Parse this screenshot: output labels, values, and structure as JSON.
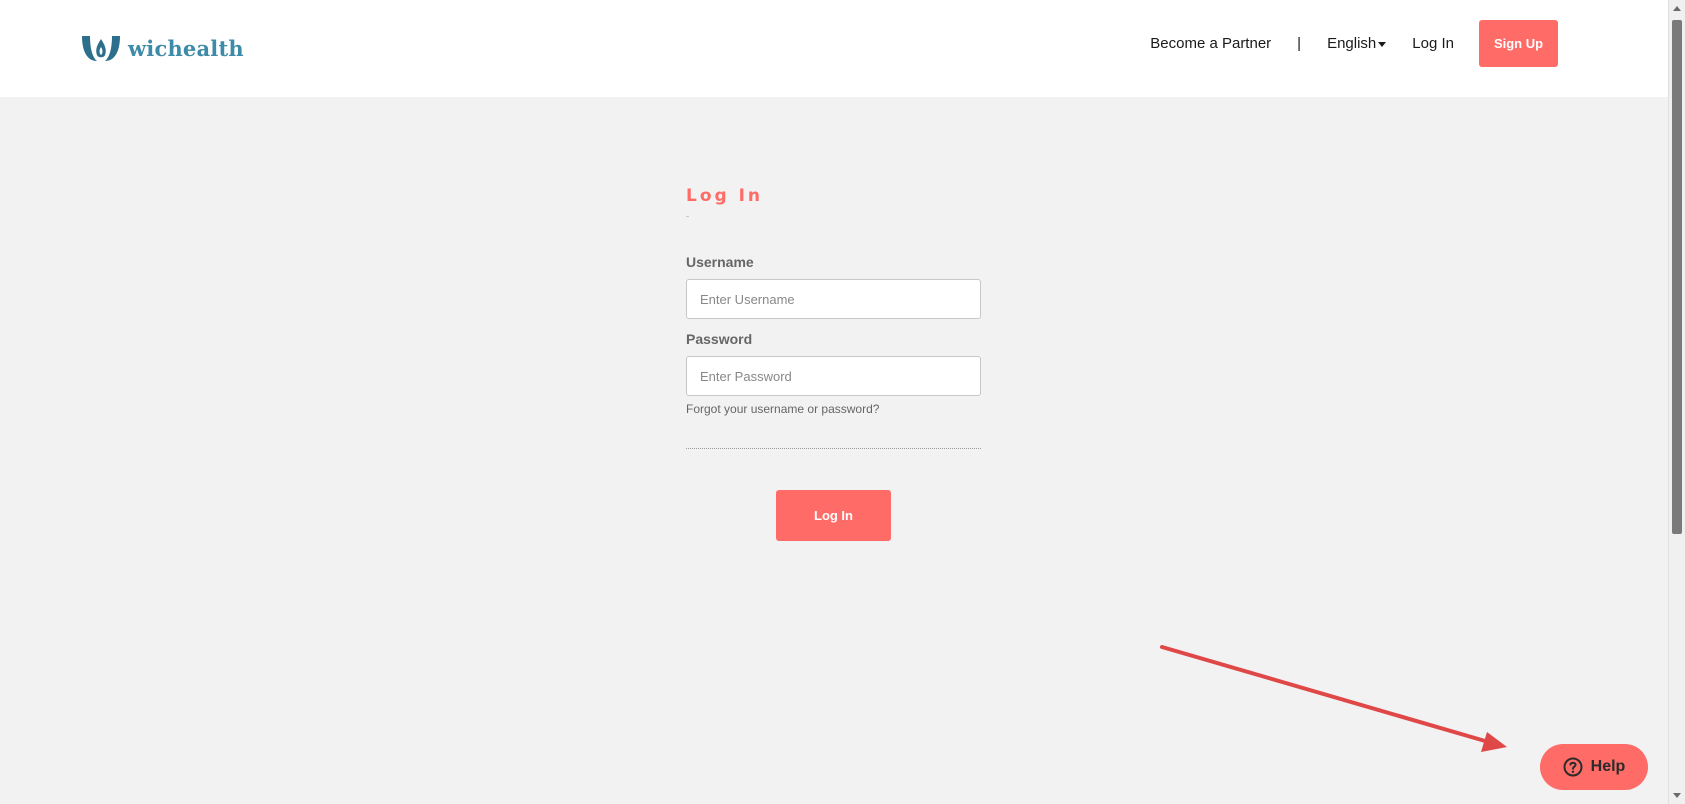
{
  "brand": {
    "name": "wichealth",
    "logo_icon": "wichealth-logo-icon",
    "accent_color": "#ff6b66",
    "logo_color": "#3d8ba8"
  },
  "nav": {
    "partner_label": "Become a Partner",
    "separator": "|",
    "language_label": "English",
    "login_label": "Log In",
    "signup_label": "Sign Up"
  },
  "form": {
    "title": "Log In",
    "username": {
      "label": "Username",
      "value": "",
      "placeholder": "Enter Username"
    },
    "password": {
      "label": "Password",
      "value": "",
      "placeholder": "Enter Password"
    },
    "forgot_label": "Forgot your username or password?",
    "submit_label": "Log In"
  },
  "help": {
    "label": "Help",
    "icon": "question-circle-icon"
  },
  "annotation": {
    "icon": "red-arrow-annotation",
    "color": "#e04848"
  }
}
